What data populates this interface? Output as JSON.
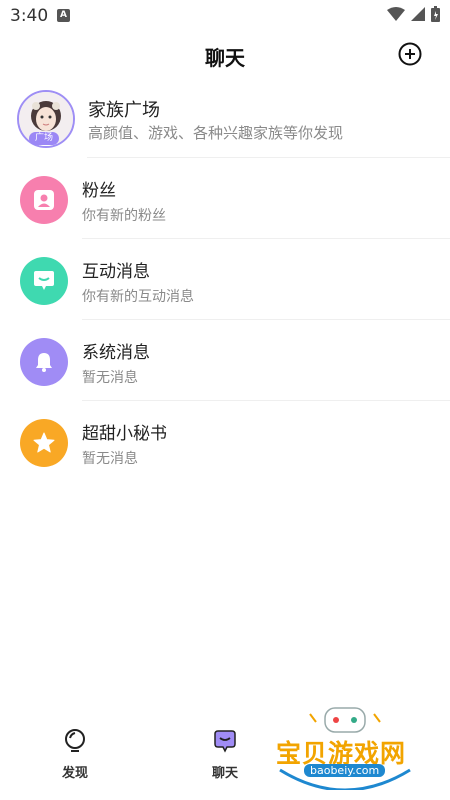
{
  "status_bar": {
    "time": "3:40",
    "notification_icon_letter": "A"
  },
  "header": {
    "title": "聊天"
  },
  "chat_list": [
    {
      "title": "家族广场",
      "subtitle": "高颜值、游戏、各种兴趣家族等你发现",
      "badge": "广场",
      "icon": "avatar"
    },
    {
      "title": "粉丝",
      "subtitle": "你有新的粉丝",
      "icon": "person-icon",
      "color": "#f77fae"
    },
    {
      "title": "互动消息",
      "subtitle": "你有新的互动消息",
      "icon": "chat-bubble-icon",
      "color": "#3fd9b0"
    },
    {
      "title": "系统消息",
      "subtitle": "暂无消息",
      "icon": "bell-icon",
      "color": "#a08cf5"
    },
    {
      "title": "超甜小秘书",
      "subtitle": "暂无消息",
      "icon": "star-icon",
      "color": "#f9a825"
    }
  ],
  "bottom_nav": [
    {
      "label": "发现",
      "icon": "bulb-icon"
    },
    {
      "label": "聊天",
      "icon": "chat-icon",
      "active": true
    }
  ],
  "watermark": {
    "text": "宝贝游戏网",
    "url": "baobeiy.com"
  },
  "colors": {
    "accent": "#9b87f5",
    "fans": "#f77fae",
    "interaction": "#3fd9b0",
    "system": "#a08cf5",
    "secretary": "#f9a825"
  }
}
